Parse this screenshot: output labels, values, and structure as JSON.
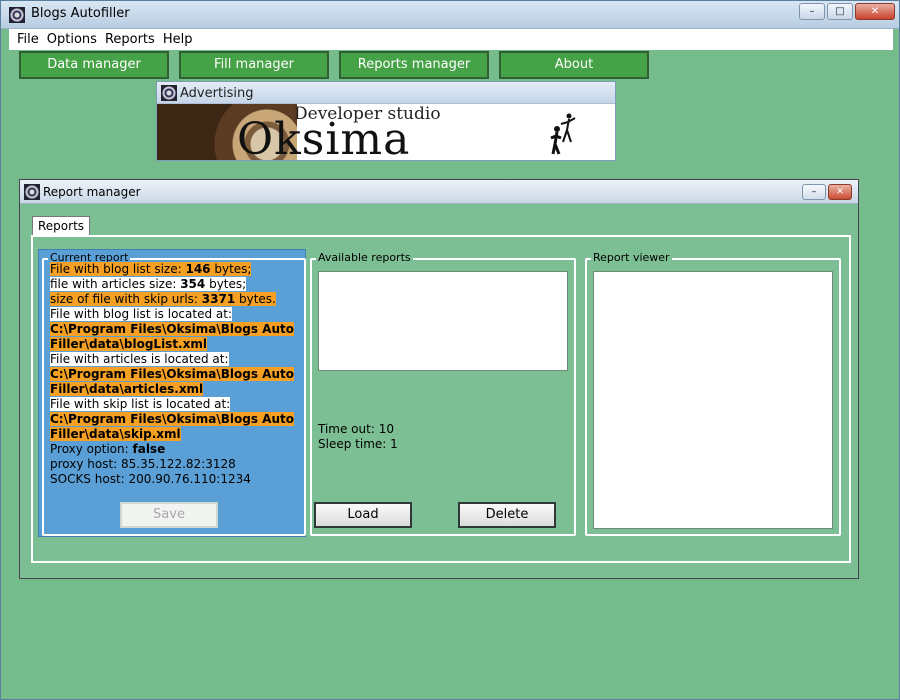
{
  "app": {
    "title": "Blogs Autofiller"
  },
  "window_controls": {
    "minimize": "–",
    "maximize": "□",
    "close": "✕"
  },
  "menu": [
    "File",
    "Options",
    "Reports",
    "Help"
  ],
  "nav": [
    "Data manager",
    "Fill manager",
    "Reports manager",
    "About"
  ],
  "ad": {
    "title": "Advertising",
    "subtitle": "Developer studio",
    "brand": "Oksima"
  },
  "report_window": {
    "title": "Report manager",
    "tab": "Reports",
    "current_report": {
      "label": "Current report",
      "lines": [
        {
          "a": "File with blog list size: ",
          "b": "146",
          "c": " bytes;"
        },
        {
          "a": "file with articles size: ",
          "b": "354",
          "c": " bytes;"
        },
        {
          "a": "size of file with skip urls: ",
          "b": "3371",
          "c": " bytes."
        },
        {
          "a": "File with blog list is located at:"
        },
        {
          "a": "C:\\Program Files\\Oksima\\Blogs Auto"
        },
        {
          "a": "Filler\\data\\blogList.xml"
        },
        {
          "a": "File with articles is located at:"
        },
        {
          "a": "C:\\Program Files\\Oksima\\Blogs Auto"
        },
        {
          "a": "Filler\\data\\articles.xml"
        },
        {
          "a": "File with skip list is located at:"
        },
        {
          "a": "C:\\Program Files\\Oksima\\Blogs Auto"
        },
        {
          "a": "Filler\\data\\skip.xml"
        },
        {
          "a": "Proxy option: ",
          "b": "false"
        },
        {
          "a": "proxy host: 85.35.122.82:3128"
        },
        {
          "a": "SOCKS host: 200.90.76.110:1234"
        }
      ],
      "save_label": "Save"
    },
    "available": {
      "label": "Available reports",
      "timeout": "Time out: 10",
      "sleep": "Sleep time: 1",
      "load_label": "Load",
      "delete_label": "Delete"
    },
    "viewer": {
      "label": "Report viewer"
    }
  }
}
